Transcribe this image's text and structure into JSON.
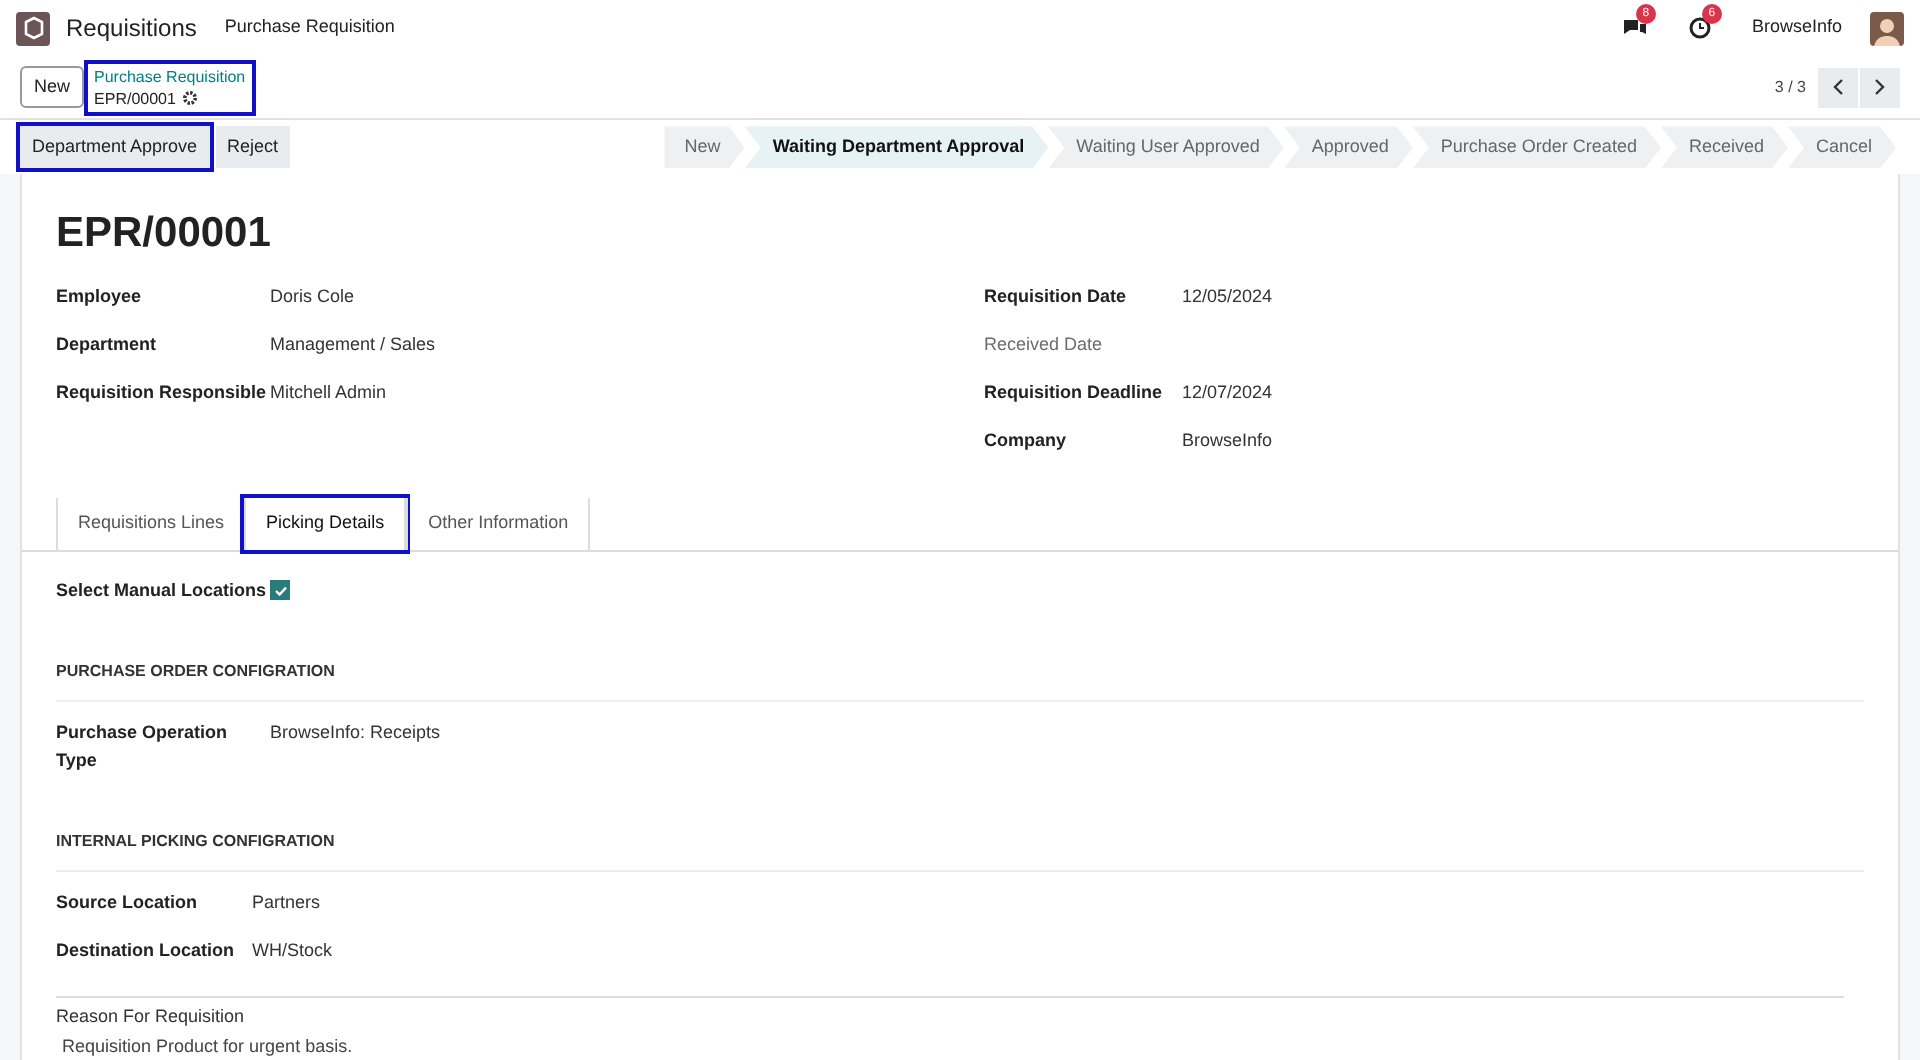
{
  "navbar": {
    "app": "Requisitions",
    "menu": "Purchase Requisition",
    "messages_badge": "8",
    "activities_badge": "6",
    "company": "BrowseInfo"
  },
  "control_panel": {
    "new_button": "New",
    "breadcrumb": "Purchase Requisition",
    "record": "EPR/00001",
    "breadcrumb_highlighted": true,
    "pager": "3 / 3"
  },
  "actions": [
    {
      "label": "Department Approve",
      "highlighted": true
    },
    {
      "label": "Reject",
      "highlighted": false
    }
  ],
  "stages": [
    {
      "label": "New",
      "selected": false
    },
    {
      "label": "Waiting Department Approval",
      "selected": true
    },
    {
      "label": "Waiting User Approved",
      "selected": false
    },
    {
      "label": "Approved",
      "selected": false
    },
    {
      "label": "Purchase Order Created",
      "selected": false
    },
    {
      "label": "Received",
      "selected": false
    },
    {
      "label": "Cancel",
      "selected": false
    }
  ],
  "title": "EPR/00001",
  "left_fields": [
    {
      "label": "Employee",
      "value": "Doris Cole",
      "required": true
    },
    {
      "label": "Department",
      "value": "Management / Sales",
      "required": true
    },
    {
      "label": "Requisition Responsible",
      "value": "Mitchell Admin",
      "required": true
    }
  ],
  "right_fields": [
    {
      "label": "Requisition Date",
      "value": "12/05/2024",
      "required": true
    },
    {
      "label": "Received Date",
      "required": false
    },
    {
      "label": "Requisition Deadline",
      "value": "12/07/2024",
      "required": true
    },
    {
      "label": "Company",
      "value": "BrowseInfo",
      "required": true
    }
  ],
  "tabs": [
    {
      "label": "Requisitions Lines",
      "selected": false,
      "highlighted": false
    },
    {
      "label": "Picking Details",
      "selected": true,
      "highlighted": true
    },
    {
      "label": "Other Information",
      "selected": false,
      "highlighted": false
    }
  ],
  "manual_locations": {
    "label": "Select Manual Locations",
    "checked": true
  },
  "sections": [
    {
      "heading": "PURCHASE ORDER CONFIGRATION",
      "fields": [
        {
          "label": "Purchase Operation Type",
          "value": "BrowseInfo: Receipts"
        }
      ]
    },
    {
      "heading": "INTERNAL PICKING CONFIGRATION",
      "fields": [
        {
          "label": "Source Location",
          "value": "Partners"
        },
        {
          "label": "Destination Location",
          "value": "WH/Stock"
        }
      ]
    }
  ],
  "reason": {
    "label": "Reason For Requisition",
    "value": "Requisition Product for urgent basis."
  }
}
